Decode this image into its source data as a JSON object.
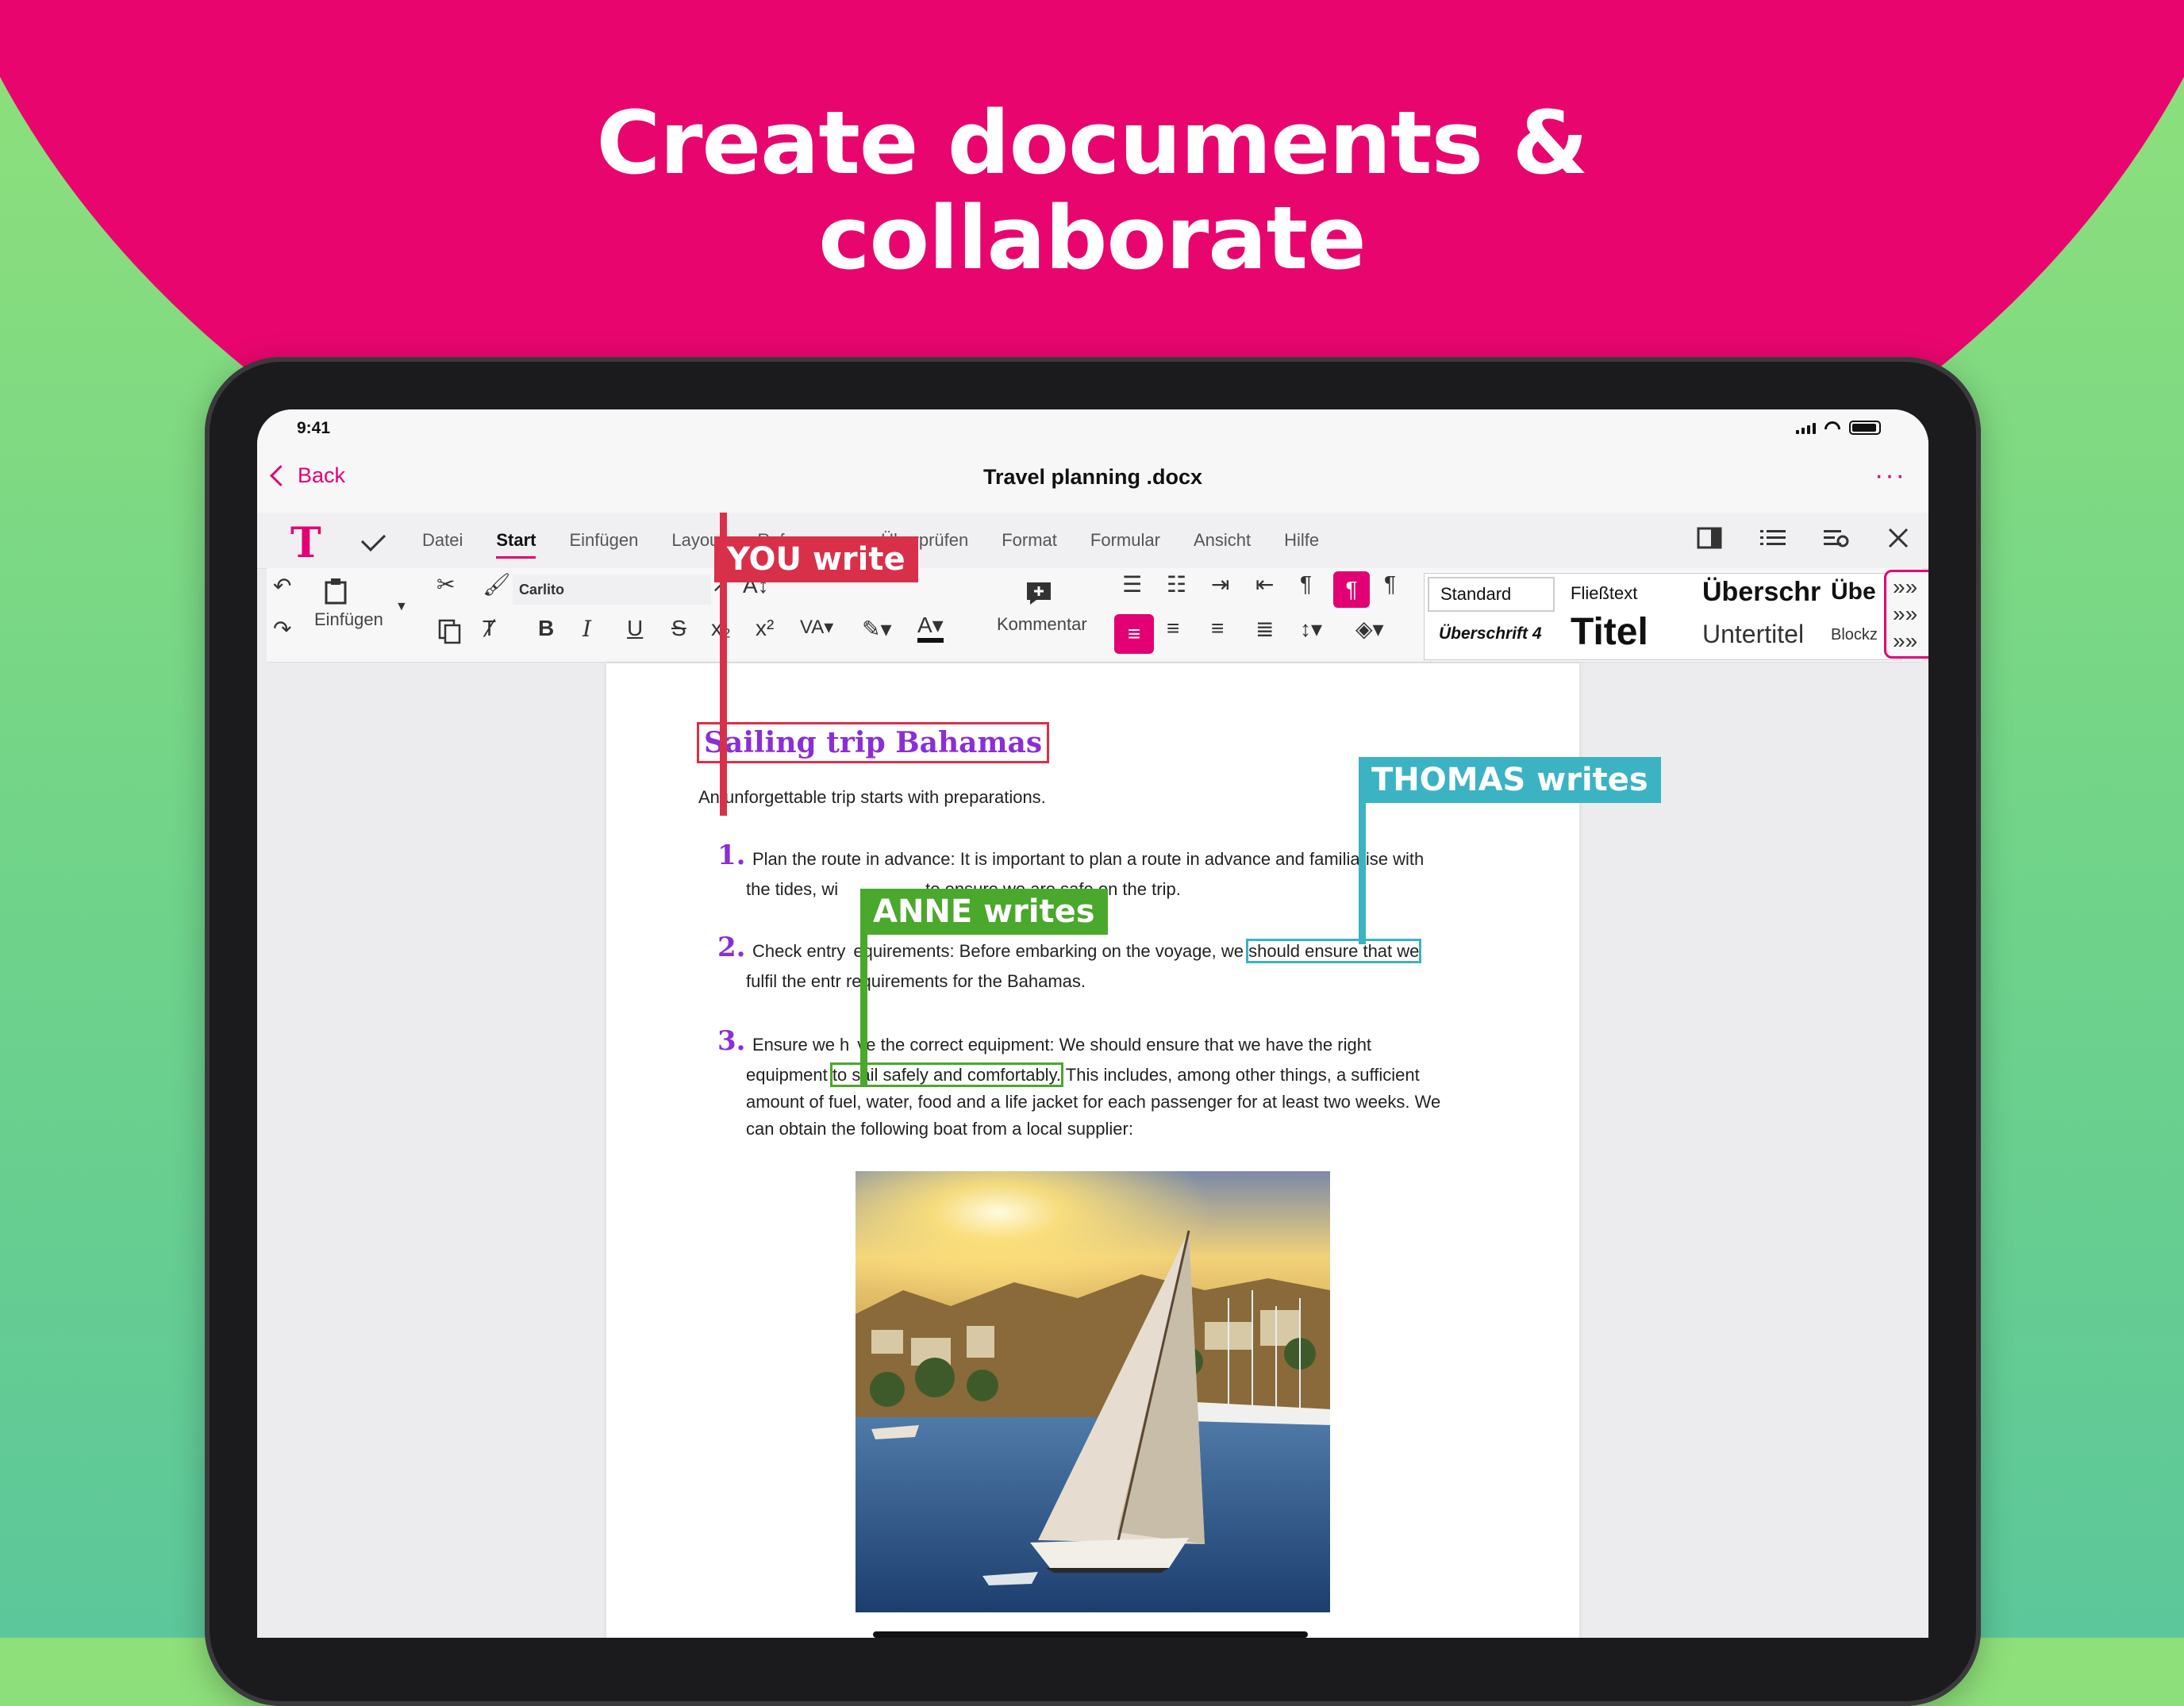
{
  "headline": {
    "line1": "Create documents &",
    "line2": "collaborate"
  },
  "status_bar": {
    "time": "9:41"
  },
  "nav": {
    "back_label": "Back",
    "title": "Travel planning .docx",
    "more_label": "···"
  },
  "ribbon_tabs": [
    "Datei",
    "Start",
    "Einfügen",
    "Layout",
    "Referenzen",
    "Überprüfen",
    "Format",
    "Formular",
    "Ansicht",
    "Hilfe"
  ],
  "ribbon_active_tab": "Start",
  "toolbar": {
    "paste_label": "Einfügen",
    "font_name": "Carlito",
    "comment_label": "Kommentar"
  },
  "styles": {
    "standard": "Standard",
    "fliesstext": "Fließtext",
    "ueberschrift1": "Überschr",
    "ueberschrift2": "Übe",
    "ueberschrift4": "Überschrift 4",
    "titel": "Titel",
    "untertitel": "Untertitel",
    "block": "Blockz"
  },
  "document": {
    "heading": "Sailing trip Bahamas",
    "intro": "An unforgettable trip starts with preparations.",
    "items": [
      {
        "num": "1.",
        "line1": "Plan the route in advance: It is important to plan a route in advance and fa",
        "line1_tail": "miliarise with",
        "line2_a": "the tides, wi",
        "line2_b": "to ensure we are safe on the trip."
      },
      {
        "num": "2.",
        "line1_a": "Check entry",
        "line1_b": "equirements: Before embarking on the voyage, we",
        "line1_hl": "should ensure that we",
        "line2_a": "fulfil the entr",
        "line2_b": " requirements for the Bahamas."
      },
      {
        "num": "3.",
        "line1_a": "Ensure we h",
        "line1_b": "ve the correct equipment: We should ensure that we have the right",
        "line2_a": "equipment",
        "line2_hl": "to sail safely and comfortably.",
        "line2_b": "This includes, among other things, a sufficient",
        "line3": "amount of fuel, water, food and a life jacket for each passenger for at least two weeks. We",
        "line4": "can obtain the following boat from a local supplier:"
      }
    ]
  },
  "callouts": {
    "you": "YOU write",
    "thomas": "THOMAS writes",
    "anne": "ANNE writes"
  },
  "colors": {
    "brand_magenta": "#e20074",
    "you": "#d9304a",
    "thomas": "#3bb3c3",
    "anne": "#4aa82c",
    "heading_purple": "#8b2ed6"
  }
}
